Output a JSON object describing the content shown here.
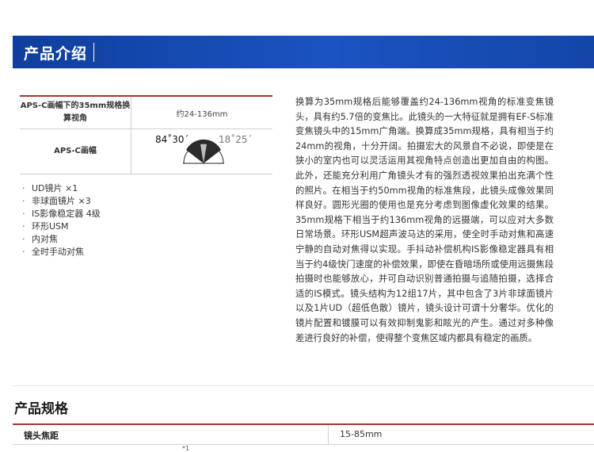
{
  "banner": {
    "title": "产品介绍"
  },
  "fov_table": {
    "row1_header": "APS-C画幅下的35mm规格换算视角",
    "row1_value": "约24-136mm",
    "row2_header": "APS-C画幅",
    "angle_wide": "84˚30´",
    "angle_tele": "18˚25´"
  },
  "features": [
    "UD镜片 ×1",
    "非球面镜片 ×3",
    "IS影像稳定器 4级",
    "环形USM",
    "内对焦",
    "全时手动对焦"
  ],
  "description": "换算为35mm规格后能够覆盖约24-136mm视角的标准变焦镜头，具有约5.7倍的变焦比。此镜头的一大特征就是拥有EF-S标准变焦镜头中的15mm广角端。换算成35mm规格，具有相当于约24mm的视角，十分开阔。拍摄宏大的风景自不必说，即使是在狭小的室内也可以灵活运用其视角特点创造出更加自由的构图。此外，还能充分利用广角镜头才有的强烈透视效果拍出充满个性的照片。在相当于约50mm视角的标准焦段，此镜头成像效果同样良好。圆形光圈的使用也是充分考虑到图像虚化效果的结果。35mm规格下相当于约136mm视角的远摄端，可以应对大多数日常场景。环形USM超声波马达的采用，使全时手动对焦和高速宁静的自动对焦得以实现。手抖动补偿机构IS影像稳定器具有相当于约4级快门速度的补偿效果，即使在昏暗场所或使用远摄焦段拍摄时也能够放心，并可自动识别普通拍摄与追随拍摄，选择合适的IS模式。镜头结构为12组17片，其中包含了3片非球面镜片以及1片UD（超低色散）镜片，镜头设计可谓十分奢华。优化的镜片配置和镀膜可以有效抑制鬼影和眩光的产生。通过对多种像差进行良好的补偿，使得整个变焦区域内都具有稳定的画质。",
  "specs": {
    "title": "产品规格",
    "rows": [
      {
        "key": "镜头焦距",
        "value": "15-85mm"
      }
    ],
    "footnote_mark": "*1"
  }
}
